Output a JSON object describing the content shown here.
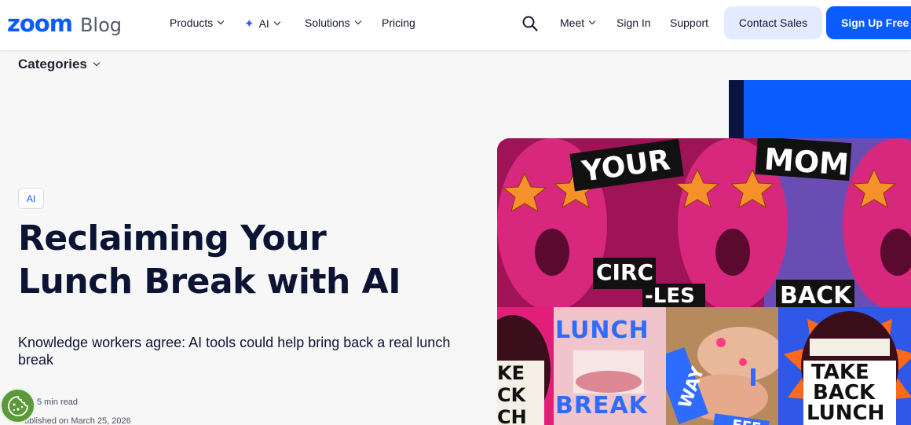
{
  "header": {
    "logo_word": "zoom",
    "logo_sub": "Blog",
    "nav": {
      "products": "Products",
      "ai": "AI",
      "solutions": "Solutions",
      "pricing": "Pricing",
      "meet": "Meet",
      "sign_in": "Sign In",
      "support": "Support"
    },
    "contact_sales": "Contact Sales",
    "sign_up": "Sign Up Free",
    "icons": {
      "search": "search-icon",
      "ai": "sparkle-icon"
    }
  },
  "categories_label": "Categories",
  "article": {
    "tag": "AI",
    "title_line1": "Reclaiming Your",
    "title_line2": "Lunch Break with AI",
    "subtitle": "Knowledge workers agree: AI tools could help bring back a real lunch break",
    "read_time": "5 min read",
    "published": "ublished on March 25, 2026"
  },
  "hero_image": {
    "words": {
      "your": "YOUR",
      "mom": "MOM",
      "circ": "CIRC",
      "les": "-LES",
      "back": "BACK",
      "lunch": "LUNCH",
      "break": "BREAK",
      "way": "WAY",
      "take_back_lunch_1": "TAKE",
      "take_back_lunch_2": "BACK",
      "take_back_lunch_3": "LUNCH",
      "left_1": "KE",
      "left_2": "CK",
      "left_3": "CH",
      "fee": "FEE"
    }
  },
  "colors": {
    "brand_blue": "#0b5cff",
    "navy": "#0b1533",
    "contact_bg": "#e4ebff",
    "magenta": "#c2186f",
    "star_orange": "#f5912b"
  }
}
